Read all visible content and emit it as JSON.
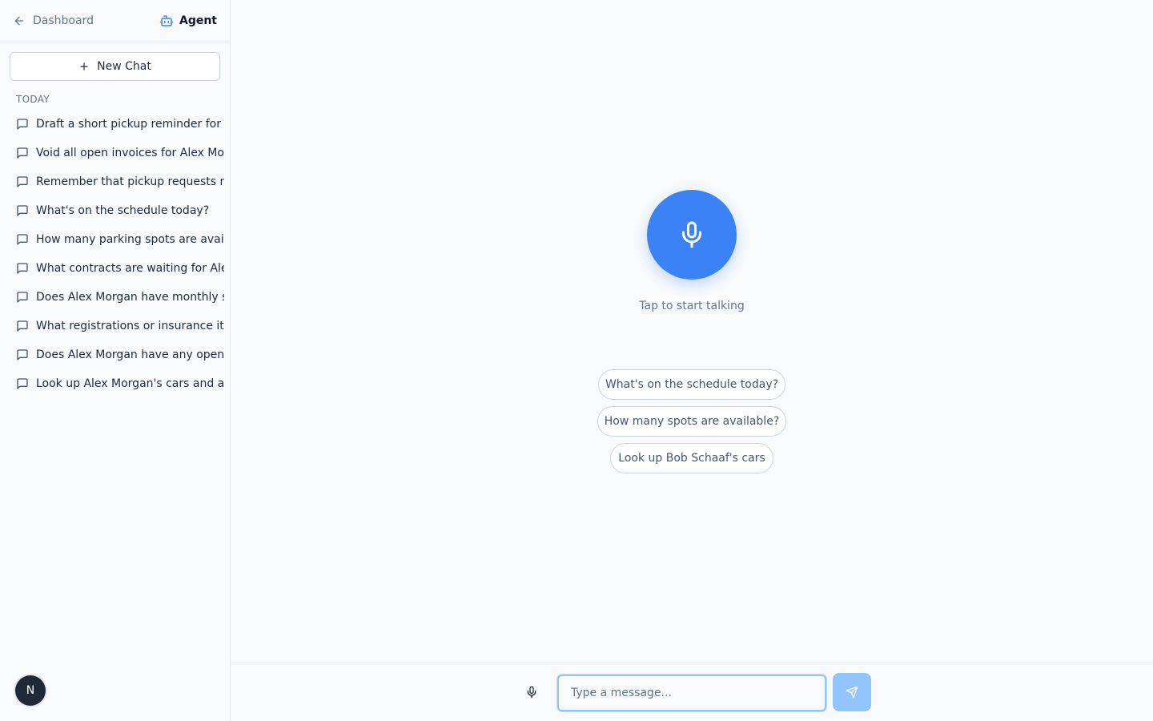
{
  "sidebar": {
    "back_label": "Dashboard",
    "agent_label": "Agent",
    "new_chat_label": "New Chat",
    "section_label": "TODAY",
    "chats": [
      {
        "label": "Draft a short pickup reminder for Al"
      },
      {
        "label": "Void all open invoices for Alex Morg"
      },
      {
        "label": "Remember that pickup requests nee"
      },
      {
        "label": "What's on the schedule today?"
      },
      {
        "label": "How many parking spots are availab"
      },
      {
        "label": "What contracts are waiting for Alex I"
      },
      {
        "label": "Does Alex Morgan have monthly sto"
      },
      {
        "label": "What registrations or insurance iten"
      },
      {
        "label": "Does Alex Morgan have any open in"
      },
      {
        "label": "Look up Alex Morgan's cars and any"
      }
    ],
    "avatar_initial": "N"
  },
  "main": {
    "tap_text": "Tap to start talking",
    "suggestions": [
      {
        "label": "What's on the schedule today?"
      },
      {
        "label": "How many spots are available?"
      },
      {
        "label": "Look up Bob Schaaf's cars"
      }
    ]
  },
  "composer": {
    "placeholder": "Type a message...",
    "value": ""
  },
  "colors": {
    "accent": "#3b82f6",
    "send_disabled": "#93c5fd"
  },
  "icons": {
    "back": "arrow-left-icon",
    "agent": "bot-icon",
    "new_chat": "plus-icon",
    "chat": "message-square-icon",
    "mic": "mic-icon",
    "send": "send-icon"
  }
}
